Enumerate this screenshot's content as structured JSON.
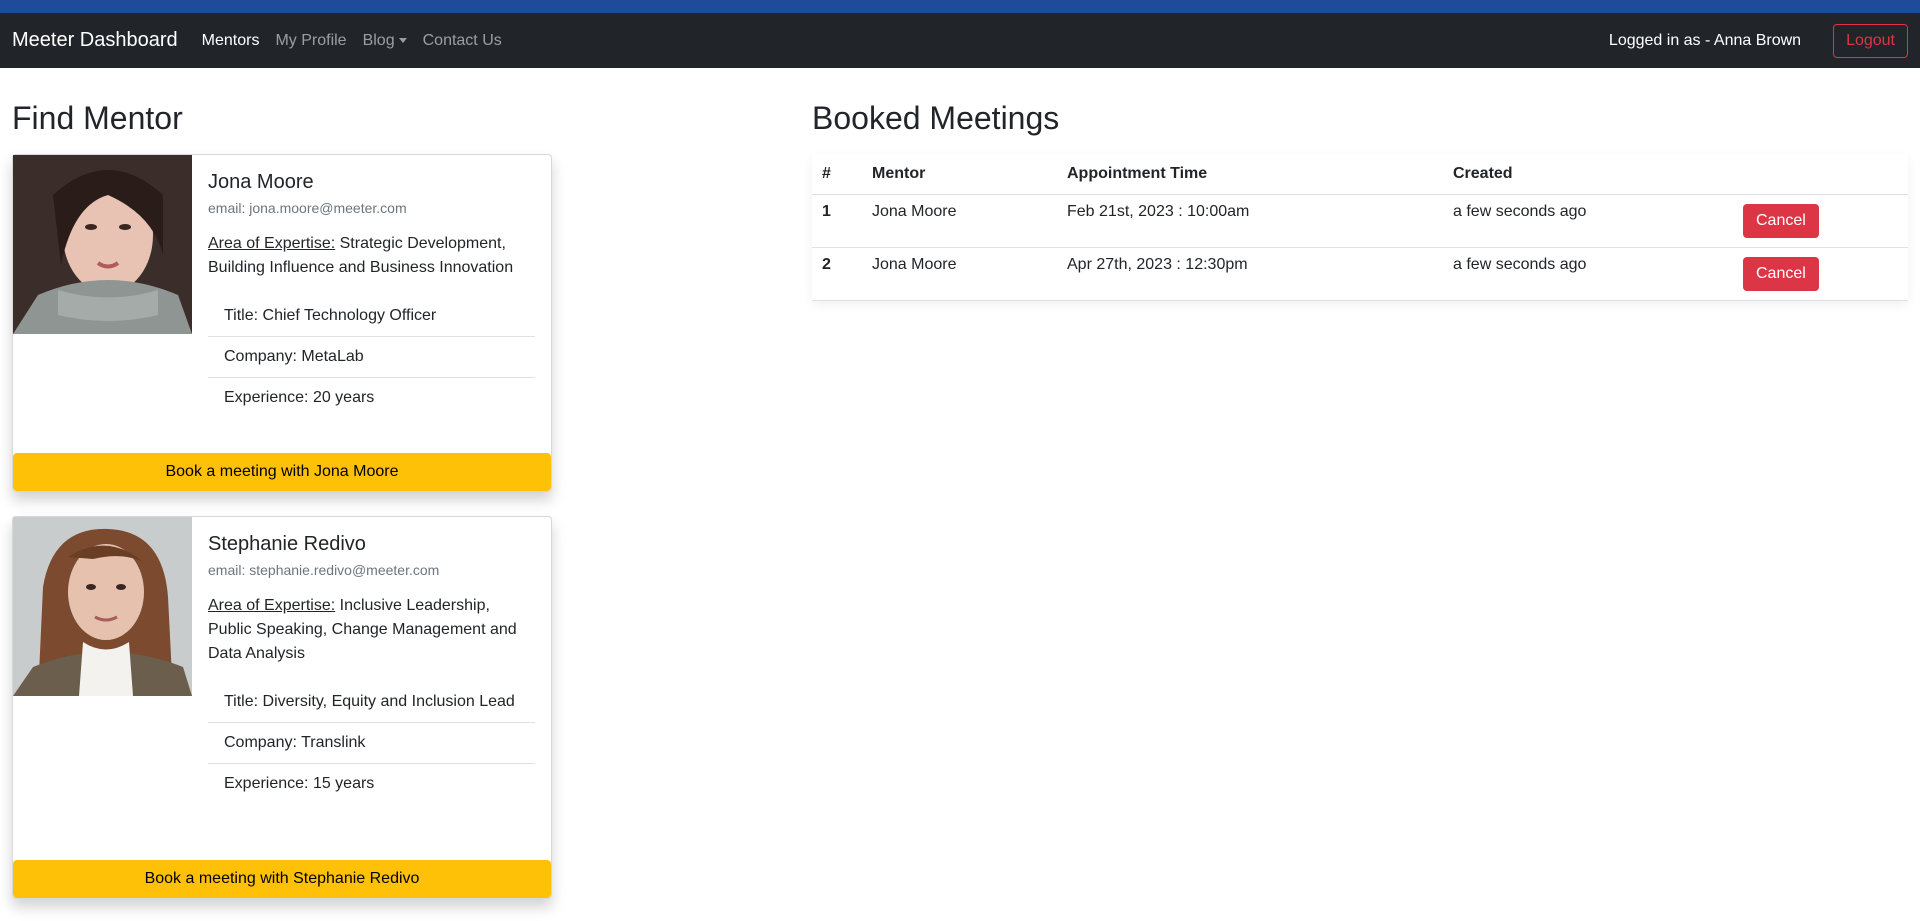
{
  "nav": {
    "brand": "Meeter Dashboard",
    "links": [
      "Mentors",
      "My Profile",
      "Blog",
      "Contact Us"
    ],
    "logged_in": "Logged in as - Anna Brown",
    "logout": "Logout"
  },
  "find_mentor": {
    "title": "Find Mentor",
    "mentors": [
      {
        "name": "Jona Moore",
        "email": "email: jona.moore@meeter.com",
        "expertise_label": "Area of Expertise:",
        "expertise": " Strategic Development, Building Influence and Business Innovation",
        "title": "Title: Chief Technology Officer",
        "company": "Company: MetaLab",
        "experience": "Experience: 20 years",
        "book": "Book a meeting with Jona Moore"
      },
      {
        "name": "Stephanie Redivo",
        "email": "email: stephanie.redivo@meeter.com",
        "expertise_label": "Area of Expertise:",
        "expertise": " Inclusive Leadership, Public Speaking, Change Management and Data Analysis",
        "title": "Title: Diversity, Equity and Inclusion Lead",
        "company": "Company: Translink",
        "experience": "Experience: 15 years",
        "book": "Book a meeting with Stephanie Redivo"
      }
    ]
  },
  "booked": {
    "title": "Booked Meetings",
    "headers": [
      "#",
      "Mentor",
      "Appointment Time",
      "Created"
    ],
    "rows": [
      {
        "num": "1",
        "mentor": "Jona Moore",
        "time": "Feb 21st, 2023 : 10:00am",
        "created": "a few seconds ago",
        "action": "Cancel"
      },
      {
        "num": "2",
        "mentor": "Jona Moore",
        "time": "Apr 27th, 2023 : 12:30pm",
        "created": "a few seconds ago",
        "action": "Cancel"
      }
    ]
  }
}
